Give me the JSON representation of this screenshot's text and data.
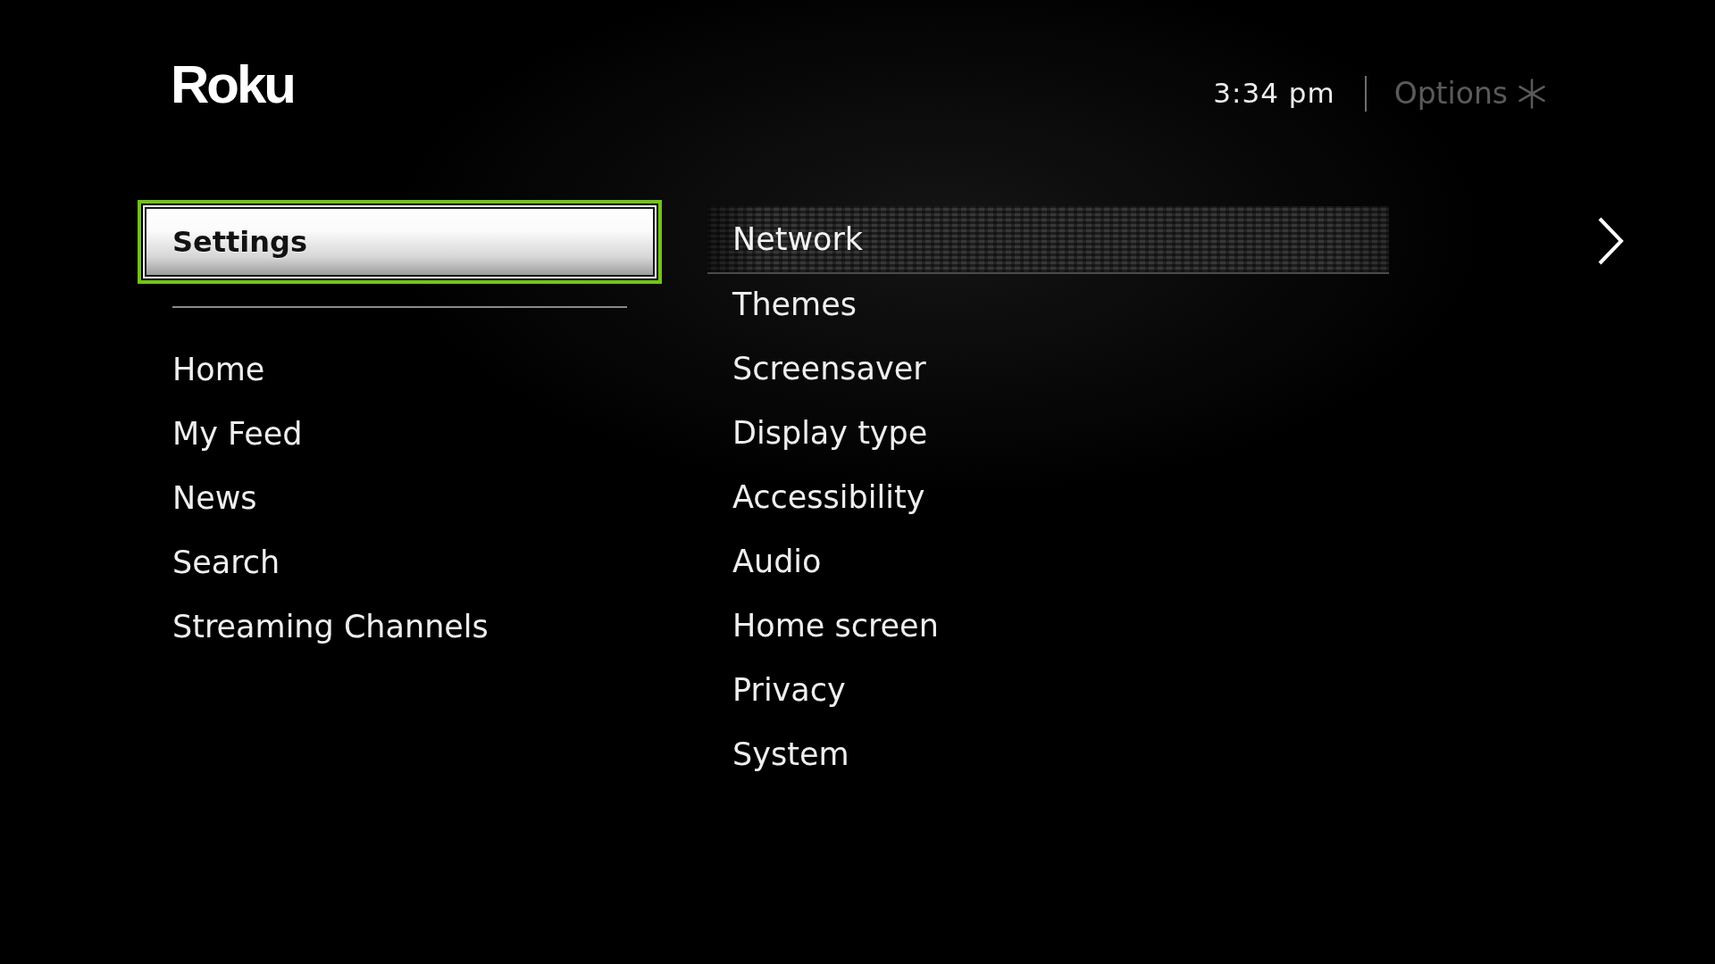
{
  "header": {
    "logo": "Roku",
    "time": "3:34 pm",
    "options_hint": "Options"
  },
  "main_menu": [
    {
      "label": "Settings",
      "selected": true
    },
    {
      "label": "Home",
      "selected": false
    },
    {
      "label": "My Feed",
      "selected": false
    },
    {
      "label": "News",
      "selected": false
    },
    {
      "label": "Search",
      "selected": false
    },
    {
      "label": "Streaming Channels",
      "selected": false
    }
  ],
  "settings_menu": [
    {
      "label": "Network",
      "selected": true
    },
    {
      "label": "Themes",
      "selected": false
    },
    {
      "label": "Screensaver",
      "selected": false
    },
    {
      "label": "Display type",
      "selected": false
    },
    {
      "label": "Accessibility",
      "selected": false
    },
    {
      "label": "Audio",
      "selected": false
    },
    {
      "label": "Home screen",
      "selected": false
    },
    {
      "label": "Privacy",
      "selected": false
    },
    {
      "label": "System",
      "selected": false
    }
  ]
}
